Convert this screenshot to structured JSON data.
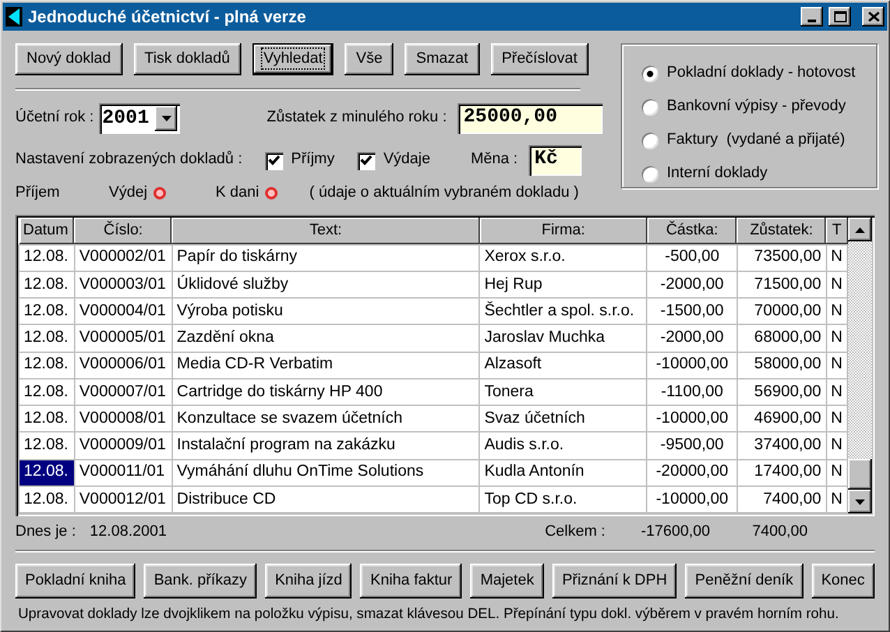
{
  "window": {
    "title": "Jednoduché účetnictví - plná verze"
  },
  "toolbar": [
    {
      "label": "Nový doklad",
      "focused": false
    },
    {
      "label": "Tisk dokladů",
      "focused": false
    },
    {
      "label": "Vyhledat",
      "focused": true
    },
    {
      "label": "Vše",
      "focused": false
    },
    {
      "label": "Smazat",
      "focused": false
    },
    {
      "label": "Přečíslovat",
      "focused": false
    }
  ],
  "year": {
    "label": "Účetní rok :",
    "value": "2001"
  },
  "balance": {
    "label": "Zůstatek z minulého roku :",
    "value": "25000,00"
  },
  "filter": {
    "label": "Nastavení zobrazených dokladů :",
    "options": [
      {
        "label": "Příjmy",
        "checked": true
      },
      {
        "label": "Výdaje",
        "checked": true
      }
    ]
  },
  "currency": {
    "label": "Měna :",
    "value": "Kč"
  },
  "indicators": [
    {
      "label": "Příjem",
      "on": false
    },
    {
      "label": "Výdej",
      "on": true
    },
    {
      "label": "K dani",
      "on": true
    }
  ],
  "indicator_note": "( údaje o aktuálním vybraném dokladu )",
  "doc_types": [
    {
      "label": "Pokladní doklady - hotovost",
      "selected": true
    },
    {
      "label": "Bankovní výpisy - převody",
      "selected": false
    },
    {
      "label": "Faktury  (vydané a přijaté)",
      "selected": false
    },
    {
      "label": "Interní doklady",
      "selected": false
    }
  ],
  "table": {
    "columns": [
      "Datum",
      "Číslo:",
      "Text:",
      "Firma:",
      "Částka:",
      "Zůstatek:",
      "T"
    ],
    "rows": [
      {
        "selected": false,
        "cells": [
          "12.08.",
          "V000002/01",
          "Papír do tiskárny",
          "Xerox s.r.o.",
          "-500,00",
          "73500,00",
          "N"
        ]
      },
      {
        "selected": false,
        "cells": [
          "12.08.",
          "V000003/01",
          "Úklidové služby",
          "Hej Rup",
          "-2000,00",
          "71500,00",
          "N"
        ]
      },
      {
        "selected": false,
        "cells": [
          "12.08.",
          "V000004/01",
          "Výroba potisku",
          "Šechtler a spol. s.r.o.",
          "-1500,00",
          "70000,00",
          "N"
        ]
      },
      {
        "selected": false,
        "cells": [
          "12.08.",
          "V000005/01",
          "Zazdění okna",
          "Jaroslav Muchka",
          "-2000,00",
          "68000,00",
          "N"
        ]
      },
      {
        "selected": false,
        "cells": [
          "12.08.",
          "V000006/01",
          "Media CD-R Verbatim",
          "Alzasoft",
          "-10000,00",
          "58000,00",
          "N"
        ]
      },
      {
        "selected": false,
        "cells": [
          "12.08.",
          "V000007/01",
          "Cartridge do tiskárny HP 400",
          "Tonera",
          "-1100,00",
          "56900,00",
          "N"
        ]
      },
      {
        "selected": false,
        "cells": [
          "12.08.",
          "V000008/01",
          "Konzultace se svazem účetních",
          "Svaz účetních",
          "-10000,00",
          "46900,00",
          "N"
        ]
      },
      {
        "selected": false,
        "cells": [
          "12.08.",
          "V000009/01",
          "Instalační program na zakázku",
          "Audis s.r.o.",
          "-9500,00",
          "37400,00",
          "N"
        ]
      },
      {
        "selected": true,
        "cells": [
          "12.08.",
          "V000011/01",
          "Vymáhání dluhu OnTime Solutions",
          "Kudla Antonín",
          "-20000,00",
          "17400,00",
          "N"
        ]
      },
      {
        "selected": false,
        "cells": [
          "12.08.",
          "V000012/01",
          "Distribuce CD",
          "Top CD s.r.o.",
          "-10000,00",
          "7400,00",
          "N"
        ]
      }
    ]
  },
  "summary": {
    "today_label": "Dnes je :",
    "today": "12.08.2001",
    "total_label": "Celkem :",
    "total_amount": "-17600,00",
    "total_balance": "7400,00"
  },
  "bottom_buttons": [
    "Pokladní kniha",
    "Bank. příkazy",
    "Kniha jízd",
    "Kniha faktur",
    "Majetek",
    "Přiznání k DPH",
    "Peněžní deník",
    "Konec"
  ],
  "status_bar": "Upravovat doklady lze dvojklikem na položku výpisu, smazat klávesou DEL. Přepínání typu dokl. výběrem v pravém horním rohu."
}
